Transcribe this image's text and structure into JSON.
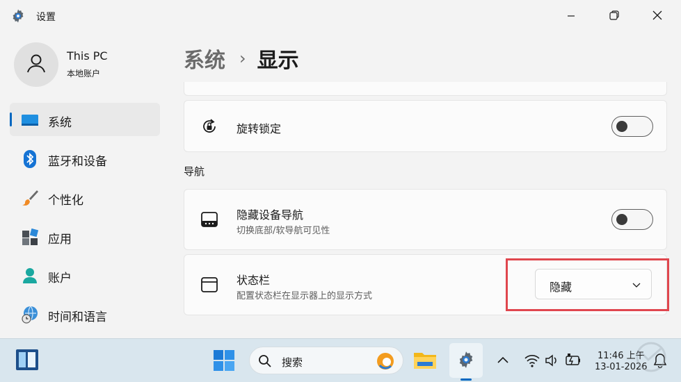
{
  "window": {
    "title": "设置",
    "icons": {
      "app": "gear-icon",
      "minimize": "minimize-icon",
      "maximize": "restore-icon",
      "close": "close-icon"
    }
  },
  "profile": {
    "name": "This PC",
    "subtitle": "本地账户"
  },
  "sidebar": {
    "items": [
      {
        "label": "系统",
        "icon": "monitor-icon",
        "active": true
      },
      {
        "label": "蓝牙和设备",
        "icon": "bluetooth-icon",
        "active": false
      },
      {
        "label": "个性化",
        "icon": "brush-icon",
        "active": false
      },
      {
        "label": "应用",
        "icon": "apps-icon",
        "active": false
      },
      {
        "label": "账户",
        "icon": "person-icon",
        "active": false
      },
      {
        "label": "时间和语言",
        "icon": "globe-clock-icon",
        "active": false
      }
    ]
  },
  "breadcrumb": {
    "parent": "系统",
    "separator": "›",
    "current": "显示"
  },
  "settings": {
    "rotation_lock": {
      "title": "旋转锁定",
      "enabled": false
    },
    "section_nav_label": "导航",
    "hide_nav": {
      "title": "隐藏设备导航",
      "subtitle": "切换底部/软导航可见性",
      "enabled": false
    },
    "status_bar": {
      "title": "状态栏",
      "subtitle": "配置状态栏在显示器上的显示方式",
      "value": "隐藏"
    }
  },
  "taskbar": {
    "search_label": "搜索",
    "time": "11:46 上午",
    "date": "13-01-2026",
    "icons": [
      "widgets-icon",
      "start-icon",
      "search-icon",
      "edge-badge-icon",
      "file-explorer-icon",
      "settings-icon",
      "chevron-up-icon",
      "wifi-icon",
      "volume-icon",
      "battery-icon",
      "notification-bell-icon"
    ]
  },
  "colors": {
    "accent": "#0067c0",
    "highlight_border": "#e0464e",
    "taskbar": "#d9e6ee",
    "background": "#f3f3f3"
  }
}
